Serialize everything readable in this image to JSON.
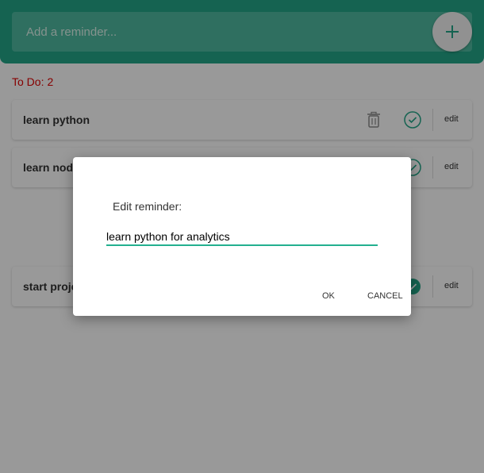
{
  "header": {
    "placeholder": "Add a reminder...",
    "add_icon": "plus-icon"
  },
  "todo": {
    "label": "To Do:",
    "count": "2"
  },
  "items": [
    {
      "label": "learn python",
      "edit_label": "edit",
      "done": false
    },
    {
      "label": "learn node",
      "edit_label": "edit",
      "done": false
    },
    {
      "label": "start proje",
      "edit_label": "edit",
      "done": true
    }
  ],
  "dialog": {
    "title": "Edit reminder:",
    "input_value": "learn python for analytics",
    "ok_label": "OK",
    "cancel_label": "CANCEL"
  },
  "colors": {
    "header": "#23a688",
    "accent": "#23b08f",
    "count_text": "#e00000"
  }
}
